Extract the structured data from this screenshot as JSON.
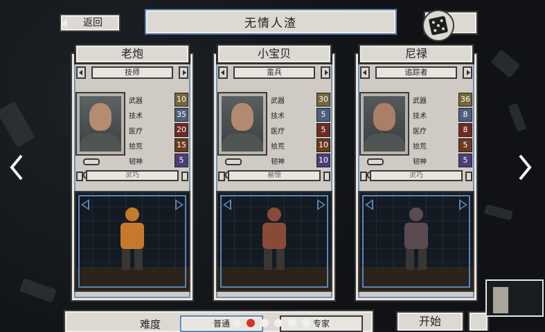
{
  "header": {
    "back_label": "返回",
    "title": "无情人渣"
  },
  "stat_labels": {
    "weapon": "武器",
    "tech": "技术",
    "medical": "医疗",
    "salvage": "拾荒",
    "mental": "韧神"
  },
  "characters": [
    {
      "name": "老炮",
      "class": "技师",
      "trait": "灵巧",
      "stats": {
        "weapon": "10",
        "tech": "35",
        "medical": "20",
        "salvage": "15",
        "mental": "5"
      },
      "colors": {
        "skin": "#b48c72",
        "armor": "#c47a2a",
        "bg": "#5d6263"
      }
    },
    {
      "name": "小宝贝",
      "class": "蛮兵",
      "trait": "易惊",
      "stats": {
        "weapon": "30",
        "tech": "5",
        "medical": "5",
        "salvage": "10",
        "mental": "10"
      },
      "colors": {
        "skin": "#b18a6f",
        "armor": "#8a4a38",
        "bg": "#5a5f60"
      }
    },
    {
      "name": "尼禄",
      "class": "追踪者",
      "trait": "灵巧",
      "stats": {
        "weapon": "36",
        "tech": "8",
        "medical": "8",
        "salvage": "5",
        "mental": "5"
      },
      "colors": {
        "skin": "#a97f66",
        "armor": "#5c4a52",
        "bg": "#55595a"
      }
    }
  ],
  "footer": {
    "difficulty_label": "难度",
    "difficulty_options": [
      "普通",
      "专家"
    ],
    "selected_difficulty": "普通",
    "start_label": "开始",
    "page_dots": 6,
    "active_dot": 1
  },
  "theme": {
    "accent": "#5b86b8",
    "panel": "#dcd8d2",
    "active_dot": "#d9302a"
  }
}
